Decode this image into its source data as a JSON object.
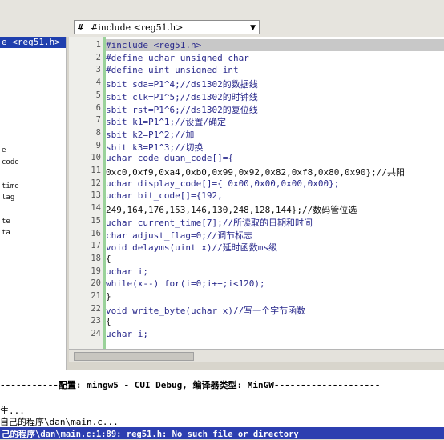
{
  "toolbar": {
    "symbol_hash": "#",
    "symbol_combo": "#include <reg51.h>"
  },
  "left_panel": {
    "selected": "e <reg51.h>",
    "items": [
      "e",
      "code",
      "time",
      "lag",
      "te",
      "ta"
    ]
  },
  "editor": {
    "lines": [
      {
        "n": "1",
        "text": "#include <reg51.h>"
      },
      {
        "n": "2",
        "text": "#define uchar unsigned char"
      },
      {
        "n": "3",
        "text": "#define uint unsigned int"
      },
      {
        "n": "4",
        "text": "sbit sda=P1^4;//ds1302的数据线"
      },
      {
        "n": "5",
        "text": "sbit clk=P1^5;//ds1302的时钟线"
      },
      {
        "n": "6",
        "text": "sbit rst=P1^6;//ds1302的复位线"
      },
      {
        "n": "7",
        "text": "sbit k1=P1^1;//设置/确定"
      },
      {
        "n": "8",
        "text": "sbit k2=P1^2;//加"
      },
      {
        "n": "9",
        "text": "sbit k3=P1^3;//切换"
      },
      {
        "n": "10",
        "text": "uchar code duan_code[]={"
      },
      {
        "n": "11",
        "text": "0xc0,0xf9,0xa4,0xb0,0x99,0x92,0x82,0xf8,0x80,0x90};//共阳"
      },
      {
        "n": "12",
        "text": "uchar display_code[]={ 0x00,0x00,0x00,0x00};"
      },
      {
        "n": "13",
        "text": "uchar bit_code[]={192,"
      },
      {
        "n": "14",
        "text": "249,164,176,153,146,130,248,128,144};//数码管位选"
      },
      {
        "n": "15",
        "text": "uchar current_time[7];//所读取的日期和时间"
      },
      {
        "n": "16",
        "text": "char adjust_flag=0;//调节标志"
      },
      {
        "n": "17",
        "text": "void delayms(uint x)//延时函数ms级"
      },
      {
        "n": "18",
        "text": "{"
      },
      {
        "n": "19",
        "text": "uchar i;"
      },
      {
        "n": "20",
        "text": "while(x--) for(i=0;i++;i<120);"
      },
      {
        "n": "21",
        "text": "}"
      },
      {
        "n": "22",
        "text": "void write_byte(uchar x)//写一个字节函数"
      },
      {
        "n": "23",
        "text": "{"
      },
      {
        "n": "24",
        "text": "uchar i;"
      }
    ]
  },
  "output": {
    "config_line": "-----------配置: mingw5 - CUI Debug, 编译器类型: MinGW--------------------",
    "line1": "生...",
    "line2": "自己的程序\\dan\\main.c...",
    "error_line": "己的程序\\dan\\main.c:1:89: reg51.h: No such file or directory"
  }
}
